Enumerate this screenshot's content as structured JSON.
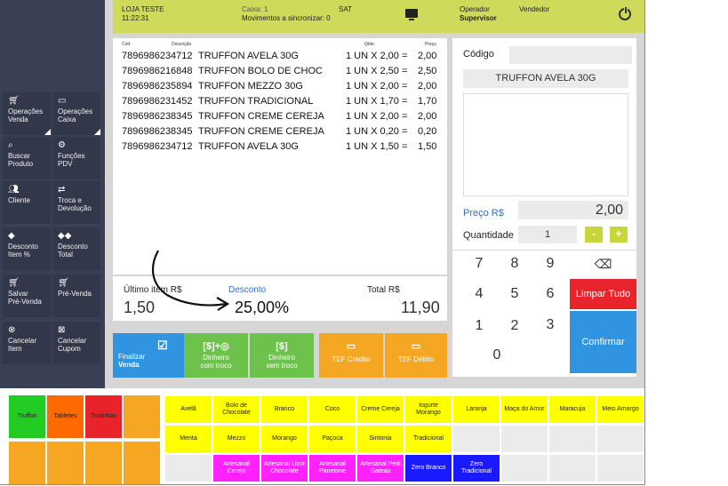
{
  "header": {
    "store": "LOJA TESTE",
    "time": "11:22:31",
    "caixa": "Caixa: 1",
    "sync": "Movimentos a sincronizar:  0",
    "sat": "SAT",
    "operador_label": "Operador",
    "operador_value": "Supervisor",
    "vendedor_label": "Vendedor"
  },
  "sidebar": {
    "items": [
      {
        "label1": "Operações",
        "label2": "Venda",
        "icon": "cart-icon"
      },
      {
        "label1": "Operações",
        "label2": "Caixa",
        "icon": "monitor-icon"
      },
      {
        "label1": "Buscar",
        "label2": "Produto",
        "icon": "search-icon"
      },
      {
        "label1": "Funções",
        "label2": "PDV",
        "icon": "gear-icon"
      },
      {
        "label1": "Cliente",
        "label2": "",
        "icon": "users-icon"
      },
      {
        "label1": "Troca e",
        "label2": "Devolução",
        "icon": "exchange-icon"
      },
      {
        "label1": "Desconto",
        "label2": "Item %",
        "icon": "tag-icon"
      },
      {
        "label1": "Desconto",
        "label2": "Total",
        "icon": "tags-icon"
      },
      {
        "label1": "Salvar",
        "label2": "Pré-Venda",
        "icon": "cart-save-icon"
      },
      {
        "label1": "Pré-Venda",
        "label2": "",
        "icon": "cart-presale-icon"
      },
      {
        "label1": "Cancelar",
        "label2": "Item",
        "icon": "cancel-item-icon"
      },
      {
        "label1": "Cancelar",
        "label2": "Cupom",
        "icon": "cancel-receipt-icon"
      }
    ]
  },
  "list": {
    "headers": {
      "cod": "Cód.",
      "desc": "Descrição",
      "qtde": "Qtde.",
      "preco": "Preço"
    },
    "rows": [
      {
        "cod": "7896986234712",
        "desc": "TRUFFON AVELA 30G",
        "qtde": "1 UN X 2,00 =",
        "preco": "2,00"
      },
      {
        "cod": "7896986216848",
        "desc": "TRUFFON BOLO DE CHOC",
        "qtde": "1 UN X 2,50 =",
        "preco": "2,50"
      },
      {
        "cod": "7896986235894",
        "desc": "TRUFFON MEZZO 30G",
        "qtde": "1 UN X 2,00 =",
        "preco": "2,00"
      },
      {
        "cod": "7896986231452",
        "desc": "TRUFFON TRADICIONAL",
        "qtde": "1 UN X 1,70 =",
        "preco": "1,70"
      },
      {
        "cod": "7896986238345",
        "desc": "TRUFFON CREME CEREJA",
        "qtde": "1 UN X 2,00 =",
        "preco": "2,00"
      },
      {
        "cod": "7896986238345",
        "desc": "TRUFFON CREME CEREJA",
        "qtde": "1 UN X 0,20 =",
        "preco": "0,20"
      },
      {
        "cod": "7896986234712",
        "desc": "TRUFFON AVELA 30G",
        "qtde": "1 UN X 1,50 =",
        "preco": "1,50"
      }
    ]
  },
  "totals": {
    "ultimo_label": "Último item R$",
    "ultimo_value": "1,50",
    "desconto_label": "Desconto",
    "desconto_value": "25,00%",
    "total_label": "Total R$",
    "total_value": "11,90"
  },
  "payments": [
    {
      "label1": "Finalizar",
      "label2": "Venda",
      "icon": "check-icon",
      "icon_text": "☑",
      "color": "#3194e0"
    },
    {
      "label1": "Dinheiro",
      "label2": "com troco",
      "icon": "money-coins-icon",
      "icon_text": "[$]+◎",
      "color": "#6cc24a"
    },
    {
      "label1": "Dinheiro",
      "label2": "sem troco",
      "icon": "money-icon",
      "icon_text": "[$]",
      "color": "#6cc24a"
    },
    {
      "label1": "TEF Crédito",
      "label2": "",
      "icon": "credit-card-icon",
      "icon_text": "▭",
      "color": "#f5a623"
    },
    {
      "label1": "TEF Débito",
      "label2": "",
      "icon": "debit-card-icon",
      "icon_text": "▭",
      "color": "#f5a623"
    }
  ],
  "right": {
    "codigo_label": "Código",
    "codigo_value": "",
    "product_name": "TRUFFON AVELA 30G",
    "preco_label": "Preço R$",
    "preco_value": "2,00",
    "qtd_label": "Quantidade",
    "qtd_value": "1",
    "minus": "-",
    "plus": "+"
  },
  "keypad": {
    "keys": [
      "7",
      "8",
      "9",
      "4",
      "5",
      "6",
      "1",
      "2",
      "3",
      "0"
    ],
    "backspace_icon": "backspace-icon",
    "limpar": "Limpar Tudo",
    "confirmar": "Confirmar"
  },
  "categories": [
    {
      "label": "Truffon",
      "color": "#22cc22"
    },
    {
      "label": "Tabletes",
      "color": "#ff6a00"
    },
    {
      "label": "Trufinhas",
      "color": "#e8242a"
    },
    {
      "label": "",
      "color": "#f5a623"
    },
    {
      "label": "",
      "color": "#f5a623"
    },
    {
      "label": "",
      "color": "#f5a623"
    },
    {
      "label": "",
      "color": "#f5a623"
    },
    {
      "label": "",
      "color": "#f5a623"
    }
  ],
  "flavors": [
    {
      "label": "Avelã",
      "color": "#ffff00"
    },
    {
      "label": "Bolo de Chocolate",
      "color": "#ffff00"
    },
    {
      "label": "Branco",
      "color": "#ffff00"
    },
    {
      "label": "Coco",
      "color": "#ffff00"
    },
    {
      "label": "Creme Cereja",
      "color": "#ffff00"
    },
    {
      "label": "Iogurte Morango",
      "color": "#ffff00"
    },
    {
      "label": "Laranja",
      "color": "#ffff00"
    },
    {
      "label": "Maça do Amor",
      "color": "#ffff00"
    },
    {
      "label": "Maracuja",
      "color": "#ffff00"
    },
    {
      "label": "Meio Amargo",
      "color": "#ffff00"
    },
    {
      "label": "Menta",
      "color": "#ffff00"
    },
    {
      "label": "Mezzo",
      "color": "#ffff00"
    },
    {
      "label": "Morango",
      "color": "#ffff00"
    },
    {
      "label": "Paçoca",
      "color": "#ffff00"
    },
    {
      "label": "Sintonia",
      "color": "#ffff00"
    },
    {
      "label": "Tradicional",
      "color": "#ffff00"
    },
    {
      "label": "",
      "color": "#ebebeb"
    },
    {
      "label": "",
      "color": "#ebebeb"
    },
    {
      "label": "",
      "color": "#ebebeb"
    },
    {
      "label": "",
      "color": "#ebebeb"
    },
    {
      "label": "",
      "color": "#ebebeb"
    },
    {
      "label": "Artesanal Cereja",
      "color": "#ff22ff"
    },
    {
      "label": "Artesanal Licor Chocolate",
      "color": "#ff22ff"
    },
    {
      "label": "Artesanal Panetone",
      "color": "#ff22ff"
    },
    {
      "label": "Artesanal Petit Gateau",
      "color": "#ff22ff"
    },
    {
      "label": "Zero Branco",
      "color": "#1a1aff"
    },
    {
      "label": "Zero Tradicional",
      "color": "#1a1aff"
    },
    {
      "label": "",
      "color": "#ebebeb"
    },
    {
      "label": "",
      "color": "#ebebeb"
    },
    {
      "label": "",
      "color": "#ebebeb"
    }
  ]
}
